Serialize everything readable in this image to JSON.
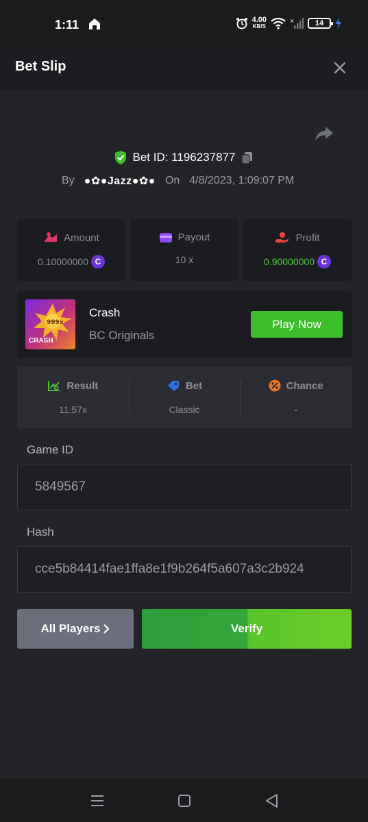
{
  "status_bar": {
    "time": "1:11",
    "speed_value": "4.00",
    "speed_unit": "KB/S",
    "battery": "14"
  },
  "header": {
    "title": "Bet Slip"
  },
  "bet": {
    "id_text": "Bet ID: 1196237877",
    "by_label": "By",
    "user": "●✿●Jazz●✿●",
    "on_label": "On",
    "datetime": "4/8/2023, 1:09:07 PM"
  },
  "stats": {
    "amount_label": "Amount",
    "amount_value": "0.10000000",
    "payout_label": "Payout",
    "payout_value": "10 x",
    "profit_label": "Profit",
    "profit_value": "0.90000000",
    "coin_symbol": "C"
  },
  "game": {
    "name": "Crash",
    "provider": "BC Originals",
    "thumb_badge": "999x",
    "thumb_label": "CRASH",
    "play_label": "Play Now"
  },
  "result": {
    "result_label": "Result",
    "result_value": "11.57x",
    "bet_label": "Bet",
    "bet_value": "Classic",
    "chance_label": "Chance",
    "chance_value": "-"
  },
  "fields": {
    "game_id_label": "Game ID",
    "game_id_value": "5849567",
    "hash_label": "Hash",
    "hash_value": "cce5b84414fae1ffa8e1f9b264f5a607a3c2b924"
  },
  "actions": {
    "all_players_label": "All Players",
    "verify_label": "Verify"
  },
  "colors": {
    "background": "#232428",
    "accent_green": "#3cbf2a",
    "coin_purple": "#6d35d6",
    "profit_green": "#4bd13a"
  }
}
